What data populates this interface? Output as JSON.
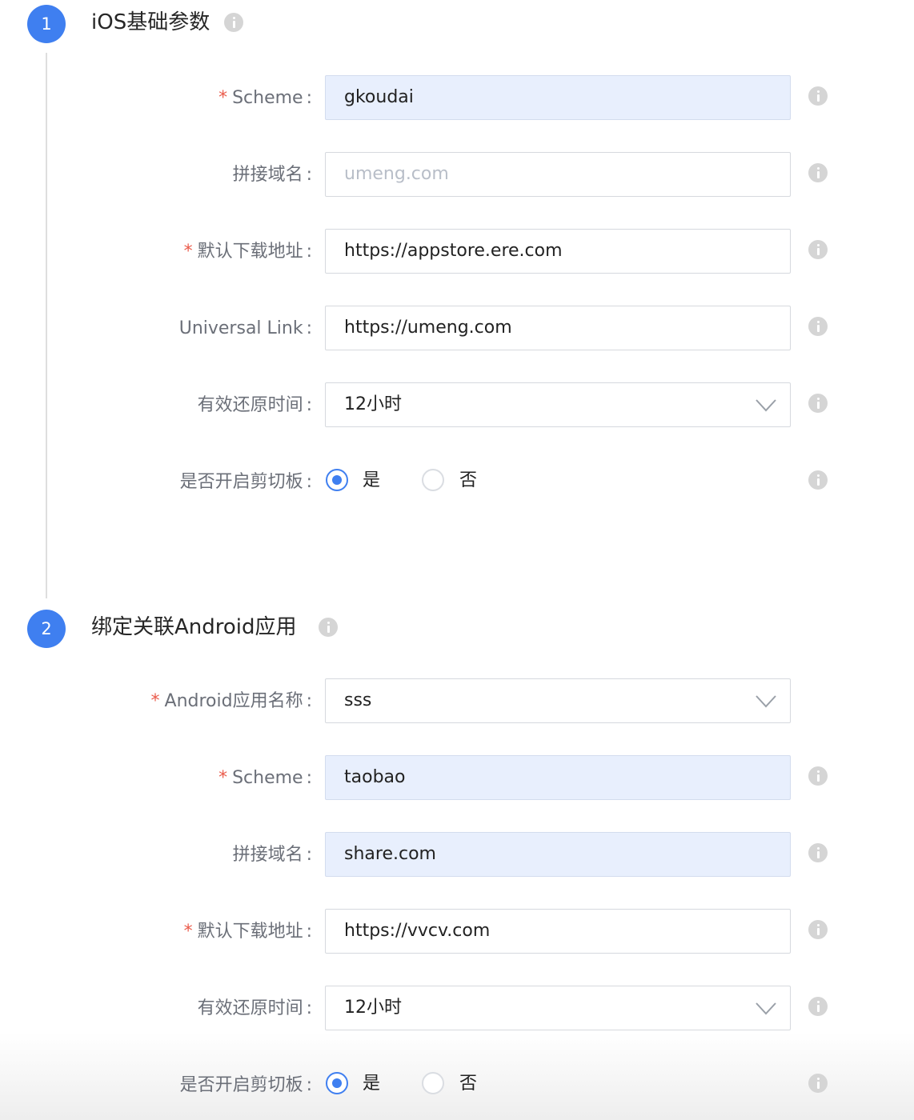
{
  "sections": [
    {
      "step": "1",
      "title": "iOS基础参数",
      "fields": [
        {
          "label": "Scheme",
          "required": true,
          "value": "gkoudai"
        },
        {
          "label": "拼接域名",
          "required": false,
          "placeholder": "umeng.com"
        },
        {
          "label": "默认下载地址",
          "required": true,
          "value": "https://appstore.ere.com"
        },
        {
          "label": "Universal Link",
          "required": false,
          "value": "https://umeng.com"
        },
        {
          "label": "有效还原时间",
          "required": false,
          "value": "12小时"
        },
        {
          "label": "是否开启剪切板",
          "required": false,
          "options": [
            "是",
            "否"
          ],
          "selected": "是"
        }
      ]
    },
    {
      "step": "2",
      "title": "绑定关联Android应用",
      "fields": [
        {
          "label": "Android应用名称",
          "required": true,
          "value": "sss"
        },
        {
          "label": "Scheme",
          "required": true,
          "value": "taobao"
        },
        {
          "label": "拼接域名",
          "required": false,
          "value": "share.com"
        },
        {
          "label": "默认下载地址",
          "required": true,
          "value": "https://vvcv.com"
        },
        {
          "label": "有效还原时间",
          "required": false,
          "value": "12小时"
        },
        {
          "label": "是否开启剪切板",
          "required": false,
          "options": [
            "是",
            "否"
          ],
          "selected": "是"
        }
      ]
    }
  ],
  "common": {
    "required_mark": "*",
    "colon": ":"
  },
  "colors": {
    "accent": "#3f7ff0",
    "required": "#ea5b4b",
    "highlight_field": "#e8effd"
  }
}
